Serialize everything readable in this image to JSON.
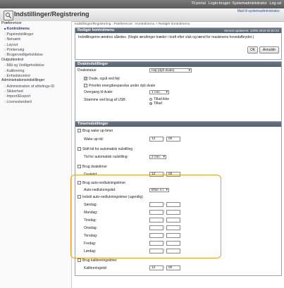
{
  "topbar": {
    "links": [
      "Til portal",
      "Login-bruger: Systemadministrator",
      "Log ud"
    ]
  },
  "header": {
    "title": "Indstillinger/Registrering",
    "mail": "Mail til systemadministrator"
  },
  "sidebar": {
    "sections": [
      {
        "label": "Præferencer",
        "items": [
          {
            "label": "Kontrolmenu",
            "active": true
          },
          {
            "label": "Papirindstillinger"
          },
          {
            "label": "Netværk"
          },
          {
            "label": "Layout"
          },
          {
            "label": "Printervalg"
          },
          {
            "label": "Brugervedligeholdelse"
          }
        ]
      },
      {
        "label": "Outputkontrol",
        "items": [
          {
            "label": "Mål og Vedligeholdelse"
          },
          {
            "label": "Kalibrering"
          },
          {
            "label": "Enhedskontrol"
          }
        ]
      },
      {
        "label": "Administrationsindstillinger",
        "items": [
          {
            "label": "Administration af afdelings-ID"
          },
          {
            "label": "Sikkerhed"
          },
          {
            "label": "Import/Eksport"
          },
          {
            "label": "Licensstandard"
          }
        ]
      }
    ]
  },
  "main": {
    "breadcrumb": "Indstillinger/Registrering : Præferencer : Kontrolmenu > Redigér kontrolmenu",
    "edit_panel": {
      "title": "Redigér kontrolmenu",
      "updated": "Senest opdateret: 10/05 2019 02:50:22",
      "notice": "Indstillingerne ændres således. (Nogle ændringer træder i kraft efter sluk og tænd for maskinens hovedafbryder.)",
      "ok": "OK",
      "cancel": "Annullér"
    },
    "sleep_panel": {
      "title": "Dvaleindstillinger",
      "status_label": "Dvalestatus:",
      "status_value": "Høj (dyb dvale)",
      "wake_on_error": "Dvale, også ved fejl",
      "prioritize": "Prioritér energibesparelse under dyb dvale",
      "transition_label": "Overgang til dvale:",
      "transition_value": "1 min.",
      "usb_label": "Strømme ved brug af USB:",
      "usb_options": [
        "Tillad ikke",
        "Tillad"
      ]
    },
    "timer_panel": {
      "title": "Timerindstillinger",
      "wakeup_check": "Brug wake up-timer",
      "wakeup_label": "Wake up-tid:",
      "wakeup_h": "12",
      "wakeup_m": "00",
      "auto_off_check": "Skift tid for automatisk nulstilling",
      "auto_off_label": "Tid for automatisk nulstilling:",
      "auto_off_value": "2 min.",
      "sleep_timer_check": "Brug dvaletimer",
      "sleep_time_label": "Dvaletid:",
      "sleep_h": "12",
      "sleep_m": "00",
      "auto_shutdown_check": "Brug auto-nedlukningstimer",
      "auto_shutdown_label": "Auto-nedlukningstid:",
      "auto_shutdown_value": "Efter 4 t.",
      "weekly_check": "Indstil auto-nedlukningstimer (ugentlig)",
      "days": [
        "Søndag:",
        "Mandag:",
        "Tirsdag:",
        "Onsdag:",
        "Torsdag:",
        "Fredag:",
        "Lørdag:"
      ],
      "calib_check": "Brug kalibreringstimer",
      "calib_label": "Kalibreringstid:",
      "calib_h": "12",
      "calib_m": "00"
    }
  }
}
